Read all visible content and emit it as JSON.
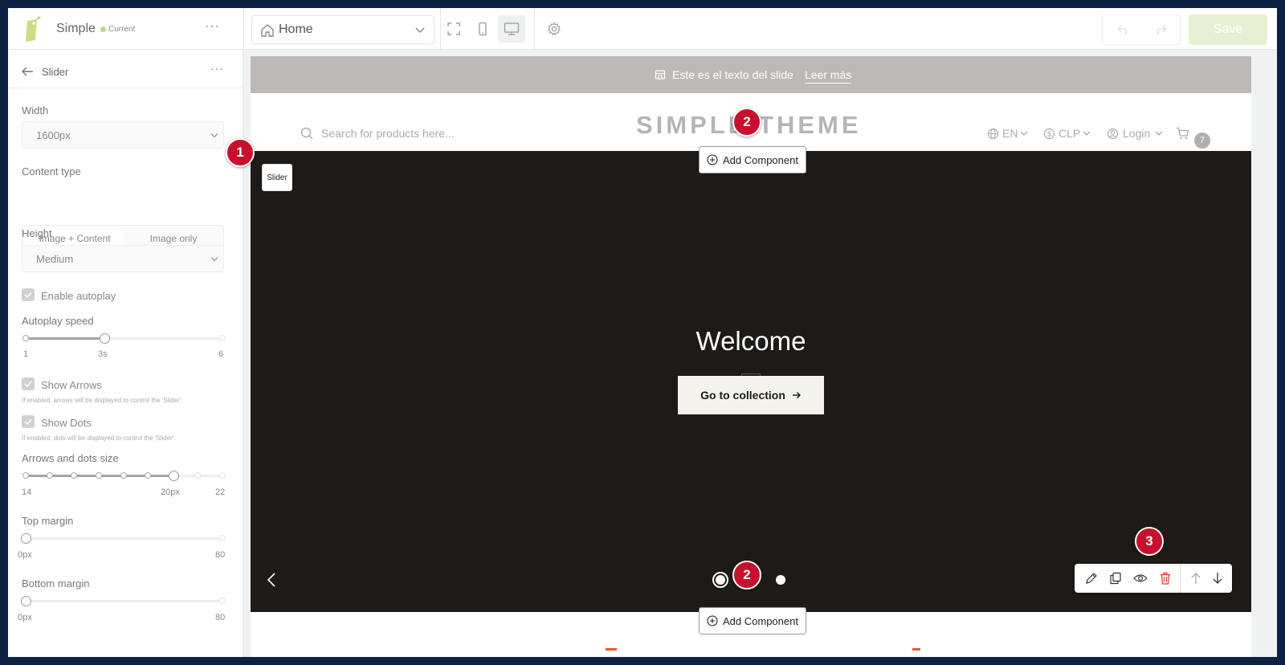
{
  "topbar": {
    "app_name": "Simple",
    "status_label": "Current",
    "page_select_value": "Home",
    "save_label": "Save",
    "colors": {
      "accent": "#b8db8a",
      "save_bg": "#e8f0d4"
    }
  },
  "sidebar": {
    "title": "Slider",
    "width_label": "Width",
    "width_value": "1600px",
    "content_type_label": "Content type",
    "content_type_options": [
      "Image + Content",
      "Image only"
    ],
    "content_type_selected": "Image + Content",
    "height_label": "Height",
    "height_value": "Medium",
    "autoplay_label": "Enable autoplay",
    "autoplay_speed_label": "Autoplay speed",
    "autoplay_speed": {
      "min": "1",
      "value": "3s",
      "max": "6",
      "fraction": 0.4
    },
    "show_arrows_label": "Show Arrows",
    "show_arrows_note": "If enabled, arrows will be displayed to control the 'Slider'.",
    "show_dots_label": "Show Dots",
    "show_dots_note": "If enabled, dots will be displayed to control the 'Slider'.",
    "size_label": "Arrows and dots size",
    "size": {
      "min": "14",
      "value": "20px",
      "max": "22",
      "fraction": 0.75
    },
    "top_margin_label": "Top margin",
    "top_margin": {
      "min": "0px",
      "max": "80",
      "fraction": 0
    },
    "bottom_margin_label": "Bottom margin",
    "bottom_margin": {
      "min": "0px",
      "max": "80",
      "fraction": 0
    }
  },
  "preview": {
    "announcement_text": "Este es el texto del slide",
    "announcement_link": "Leer más",
    "search_placeholder": "Search for products here...",
    "brand": "SIMPLE THEME",
    "language": "EN",
    "currency": "CLP",
    "login": "Login",
    "cart_count": "7",
    "hero_title": "Welcome",
    "hero_cta": "Go to collection",
    "section_tag": "Slider",
    "add_component_label": "Add Component",
    "colors": {
      "hero_bg": "#1e1a17",
      "announce_bg": "#bcb9b8",
      "marker": "#c8102e"
    }
  },
  "markers": {
    "m1": "1",
    "m2": "2",
    "m3": "3"
  }
}
